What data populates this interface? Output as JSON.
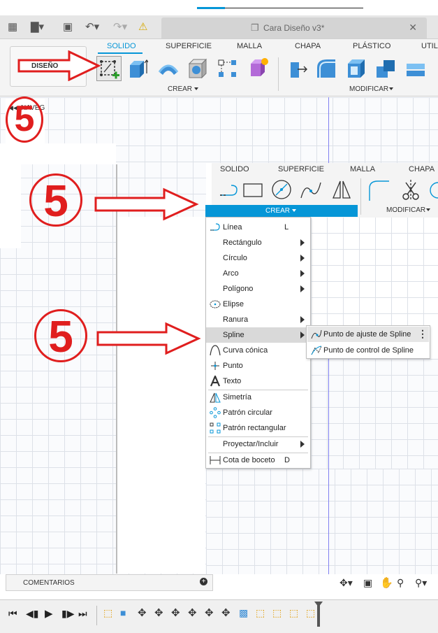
{
  "document": {
    "title": "Cara Diseño v3*"
  },
  "toolbar": {
    "workspace": "DISEÑO",
    "tabs": [
      "SOLIDO",
      "SUPERFICIE",
      "MALLA",
      "CHAPA",
      "PLÁSTICO",
      "UTILI"
    ],
    "groups": {
      "crear": "CREAR",
      "modificar": "MODIFICAR"
    }
  },
  "browser": {
    "navegador": "NAVEG"
  },
  "zoom_toolbar": {
    "tabs": [
      "SOLIDO",
      "SUPERFICIE",
      "MALLA",
      "CHAPA"
    ],
    "crear": "CREAR",
    "modificar": "MODIFICAR"
  },
  "annotations": {
    "step": "5"
  },
  "menu": {
    "items": [
      {
        "label": "Línea",
        "shortcut": "L"
      },
      {
        "label": "Rectángulo"
      },
      {
        "label": "Círculo"
      },
      {
        "label": "Arco"
      },
      {
        "label": "Polígono"
      },
      {
        "label": "Elipse"
      },
      {
        "label": "Ranura"
      },
      {
        "label": "Spline"
      },
      {
        "label": "Curva cónica"
      },
      {
        "label": "Punto"
      },
      {
        "label": "Texto"
      },
      {
        "label": "Simetría"
      },
      {
        "label": "Patrón circular"
      },
      {
        "label": "Patrón rectangular"
      },
      {
        "label": "Proyectar/Incluir"
      },
      {
        "label": "Cota de boceto",
        "shortcut": "D"
      }
    ],
    "spline_submenu": [
      {
        "label": "Punto de ajuste de Spline"
      },
      {
        "label": "Punto de control de Spline"
      }
    ]
  },
  "bottom": {
    "comments": "COMENTARIOS"
  },
  "colors": {
    "accent": "#0696d7",
    "annotation_red": "#e01e1e",
    "highlight": "#d9d9d9"
  }
}
